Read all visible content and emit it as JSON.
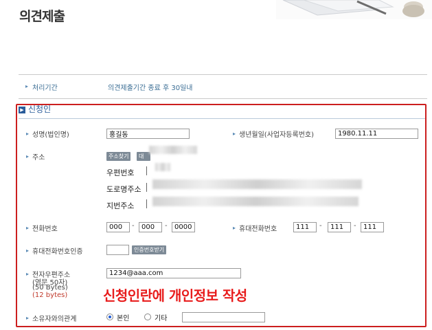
{
  "page": {
    "title": "의견제출"
  },
  "process": {
    "label": "처리기간",
    "value": "의견제출기간 종료 후 30일내"
  },
  "section": {
    "title": "신청인"
  },
  "form": {
    "name": {
      "label": "성명(법인명)",
      "value": "홍길동"
    },
    "birth": {
      "label": "생년월일(사업자등록번호)",
      "value": "1980.11.11"
    },
    "address": {
      "label": "주소",
      "find_button": "주소찾기",
      "proxy_button": "대행",
      "zip_label": "우편번호",
      "road_label": "도로명주소",
      "lot_label": "지번주소"
    },
    "phone": {
      "label": "전화번호",
      "p1": "000",
      "p2": "000",
      "p3": "0000",
      "sep": "-"
    },
    "mobile": {
      "label": "휴대전화번호",
      "p1": "111",
      "p2": "111",
      "p3": "111"
    },
    "mobile_verify": {
      "label": "휴대전화번호인증",
      "button": "인증번호받기"
    },
    "email": {
      "label": "전자우편주소",
      "note1": "(영문 50자)",
      "note2": "(50 Bytes)",
      "note3": "(12 bytes)",
      "value": "1234@aaa.com"
    },
    "relation": {
      "label": "소유자와의관계",
      "opt1": "본인",
      "opt2": "기타"
    }
  },
  "annotation": {
    "text": "신청인란에 개인정보 작성",
    "color": "#e81c1c"
  }
}
